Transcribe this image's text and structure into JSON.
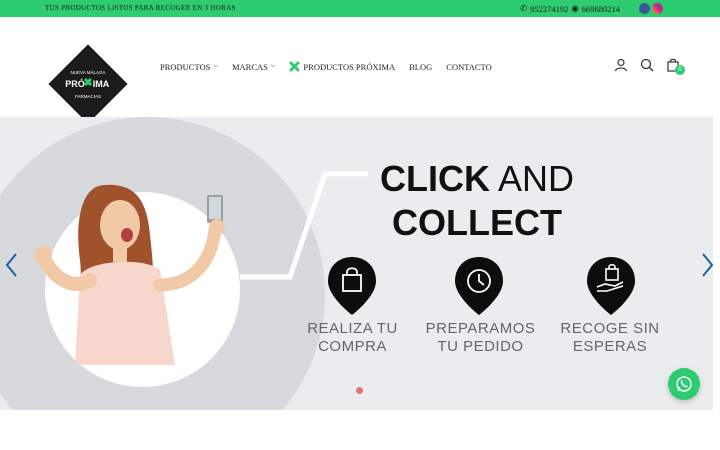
{
  "topbar": {
    "promo": "TUS PRODUCTOS LISTOS PARA RECOGER EN 3 HORAS",
    "phone": "952274192",
    "whatsapp_number": "669680214",
    "social": [
      "facebook-icon",
      "instagram-icon"
    ],
    "color": "#2ecc71"
  },
  "logo": {
    "top_text": "NUEVA MÁLAGA",
    "brand_left": "PRÓ",
    "brand_right": "IMA",
    "bottom_text": "FARMACIAS"
  },
  "nav": {
    "items": [
      {
        "label": "PRODUCTOS",
        "dropdown": true
      },
      {
        "label": "MARCAS",
        "dropdown": true
      },
      {
        "label": "PRODUCTOS PRÓXIMA",
        "icon": "cross-icon"
      },
      {
        "label": "BLOG"
      },
      {
        "label": "CONTACTO"
      }
    ]
  },
  "header_icons": {
    "cart_count": "0"
  },
  "hero": {
    "title_bold_1": "CLICK",
    "title_light": "AND",
    "title_bold_2": "COLLECT",
    "steps": [
      {
        "line1": "REALIZA TU",
        "line2": "COMPRA",
        "icon": "shopping-bag-icon"
      },
      {
        "line1": "PREPARAMOS",
        "line2": "TU PEDIDO",
        "icon": "clock-icon"
      },
      {
        "line1": "RECOGE SIN",
        "line2": "ESPERAS",
        "icon": "hand-bag-icon"
      }
    ],
    "slide_index": 1,
    "slide_count": 1
  }
}
